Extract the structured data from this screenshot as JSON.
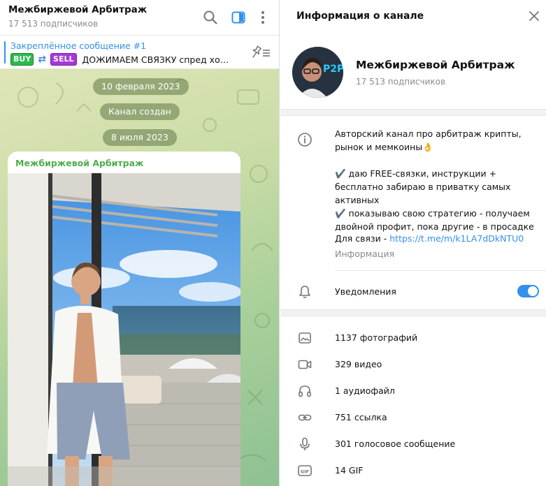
{
  "chat": {
    "title": "Межбиржевой Арбитраж",
    "subscribers": "17 513 подписчиков",
    "pinned": {
      "title": "Закреплённое сообщение #1",
      "buy": "BUY",
      "arrows": "⇄",
      "sell": "SELL",
      "text": "ДОЖИМАЕМ СВЯЗКУ  спред хороший"
    },
    "dates": [
      "10 февраля 2023",
      "Канал создан",
      "8 июля 2023"
    ],
    "message": {
      "author": "Межбиржевой Арбитраж"
    }
  },
  "info": {
    "header": "Информация о канале",
    "name": "Межбиржевой Арбитраж",
    "subscribers": "17 513 подписчиков",
    "avatar_label": "P2P",
    "about": [
      "Авторский канал про арбитраж крипты, рынок и мемкоины👌",
      "",
      "✔️ даю FREE-связки, инструкции + бесплатно забираю в приватку самых активных",
      "✔️ показываю свою стратегию - получаем двойной профит, пока другие - в просадке"
    ],
    "contact_prefix": "Для связи - ",
    "contact_link": "https://t.me/m/k1LA7dDkNTU0",
    "caption": "Информация",
    "notifications": {
      "label": "Уведомления",
      "enabled": true
    },
    "media": [
      {
        "icon": "photo-icon",
        "label": "1137 фотографий"
      },
      {
        "icon": "video-icon",
        "label": "329 видео"
      },
      {
        "icon": "headphones-icon",
        "label": "1 аудиофайл"
      },
      {
        "icon": "link-icon",
        "label": "751 ссылка"
      },
      {
        "icon": "microphone-icon",
        "label": "301 голосовое сообщение"
      },
      {
        "icon": "gif-icon",
        "label": "14 GIF"
      }
    ]
  },
  "colors": {
    "accent": "#3390ec",
    "author": "#4fae4e",
    "buy": "#2db84b",
    "sell": "#a738d8"
  }
}
